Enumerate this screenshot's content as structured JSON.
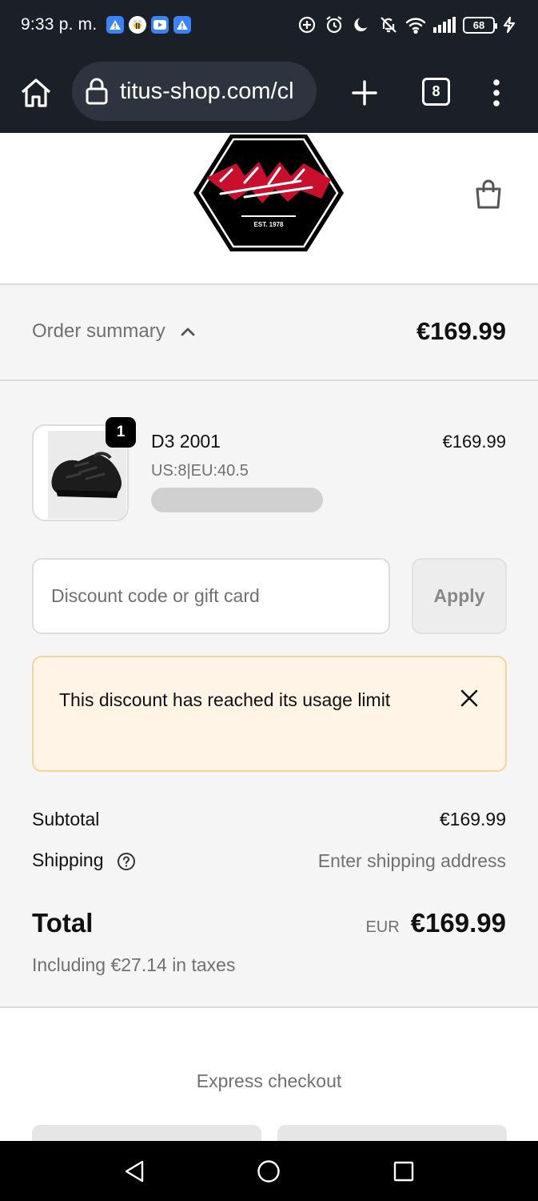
{
  "status_bar": {
    "time": "9:33 p. m.",
    "battery": "68",
    "app_icons": [
      "alert-app-icon",
      "bee-app-icon",
      "youtube-app-icon",
      "alert-app-icon"
    ],
    "system_icons": [
      "data-saver-icon",
      "alarm-icon",
      "do-not-disturb-icon",
      "notifications-off-icon",
      "wifi-icon",
      "signal-icon",
      "charging-icon"
    ]
  },
  "browser": {
    "url": "titus-shop.com/cl",
    "tab_count": "8"
  },
  "store": {
    "logo_text": "TITUS",
    "logo_subtext": "EST. 1978"
  },
  "summary": {
    "toggle_label": "Order summary",
    "total": "€169.99"
  },
  "line_item": {
    "quantity": "1",
    "name": "D3 2001",
    "variant": "US:8|EU:40.5",
    "price": "€169.99"
  },
  "discount": {
    "placeholder": "Discount code or gift card",
    "apply_label": "Apply",
    "error_message": "This discount has reached its usage limit"
  },
  "totals": {
    "subtotal_label": "Subtotal",
    "subtotal_value": "€169.99",
    "shipping_label": "Shipping",
    "shipping_value": "Enter shipping address",
    "total_label": "Total",
    "currency": "EUR",
    "total_value": "€169.99",
    "taxes_note": "Including €27.14 in taxes"
  },
  "express": {
    "title": "Express checkout"
  },
  "colors": {
    "dark_bar": "#1b1f28",
    "page_bg": "#f5f5f5",
    "alert_bg": "#fff4e6",
    "alert_border": "#f5d49b",
    "muted_text": "#707070",
    "logo_red": "#c8102e"
  }
}
